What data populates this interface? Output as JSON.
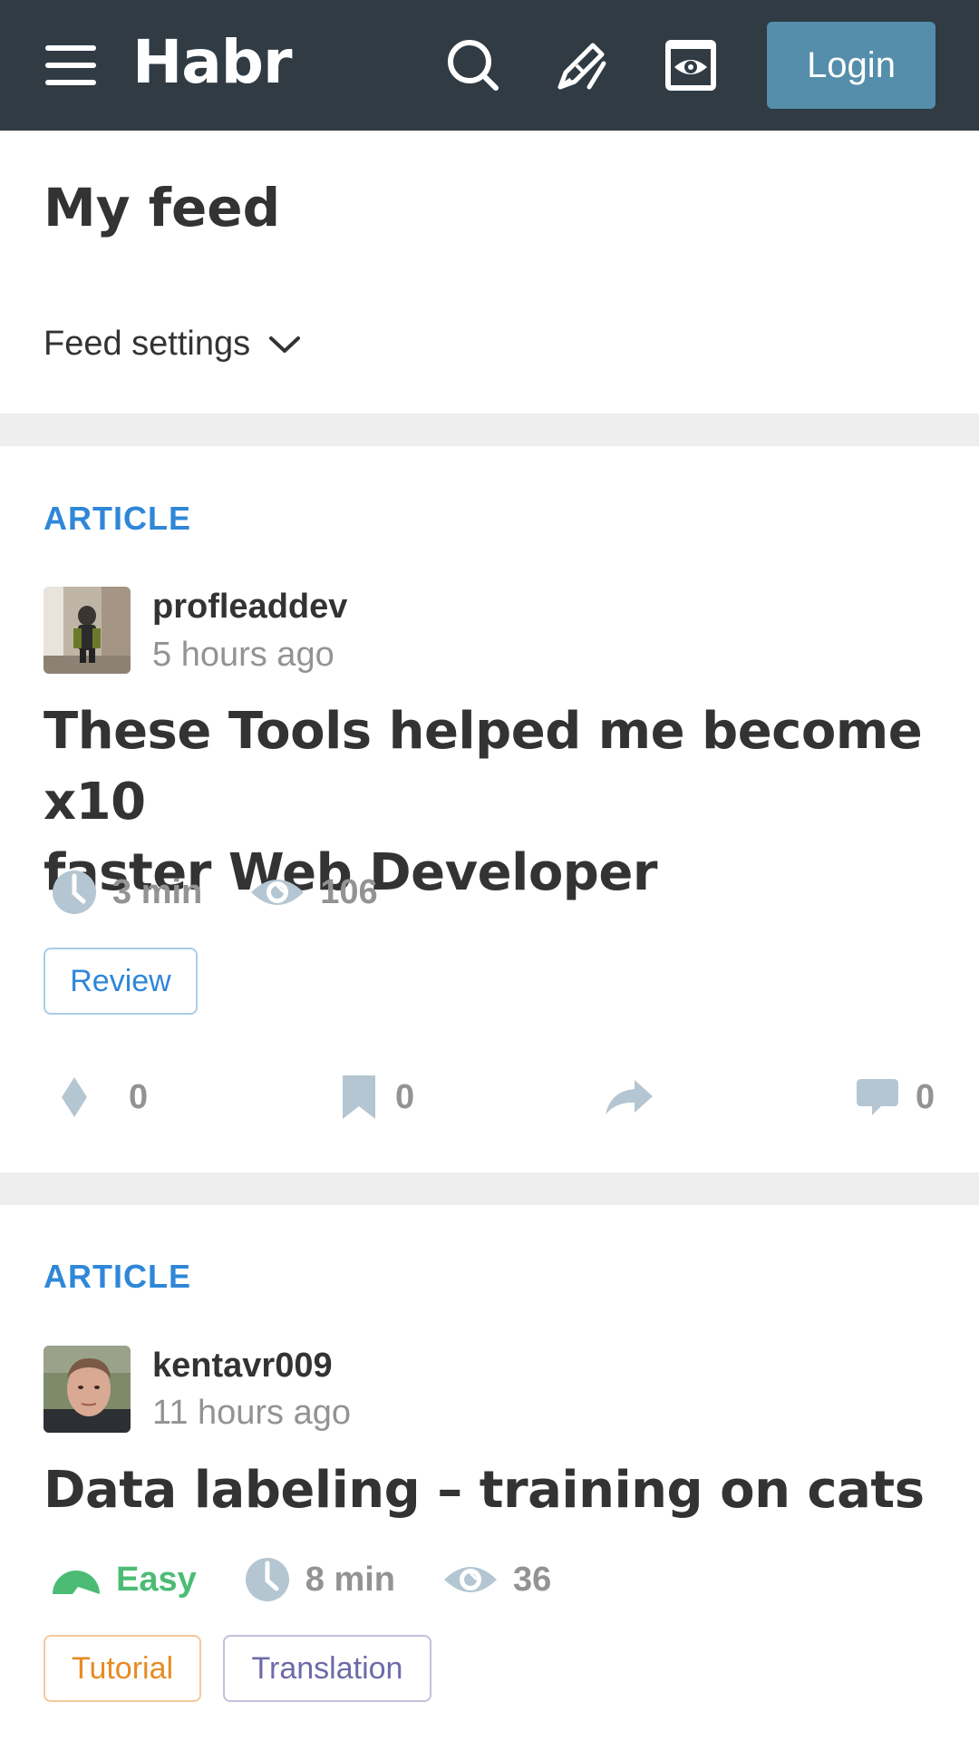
{
  "header": {
    "logo": "Habr",
    "login_label": "Login",
    "icons": [
      "menu-icon",
      "search-icon",
      "write-icon",
      "eye-icon"
    ]
  },
  "feed": {
    "title": "My feed",
    "settings_label": "Feed settings"
  },
  "posts": [
    {
      "type_label": "ARTICLE",
      "author": "profleaddev",
      "time": "5 hours ago",
      "title_line1": "These Tools helped me become x10",
      "title_line2": "faster Web Developer",
      "read_time": "3 min",
      "views": "106",
      "tags": [
        "Review"
      ],
      "votes": "0",
      "bookmarks": "0",
      "comments": "0"
    },
    {
      "type_label": "ARTICLE",
      "author": "kentavr009",
      "time": "11 hours ago",
      "title_line1": "Data labeling – training on cats",
      "difficulty": "Easy",
      "read_time": "8 min",
      "views": "36",
      "tags": [
        "Tutorial",
        "Translation"
      ]
    }
  ],
  "colors": {
    "header_bg": "#303b44",
    "login_bg": "#548eaa",
    "article_label": "#2f87d8",
    "meta_gray": "#939393",
    "easy_green": "#4cbc75",
    "tutorial_orange": "#e78b22",
    "translation_purple": "#6f6aa8"
  }
}
